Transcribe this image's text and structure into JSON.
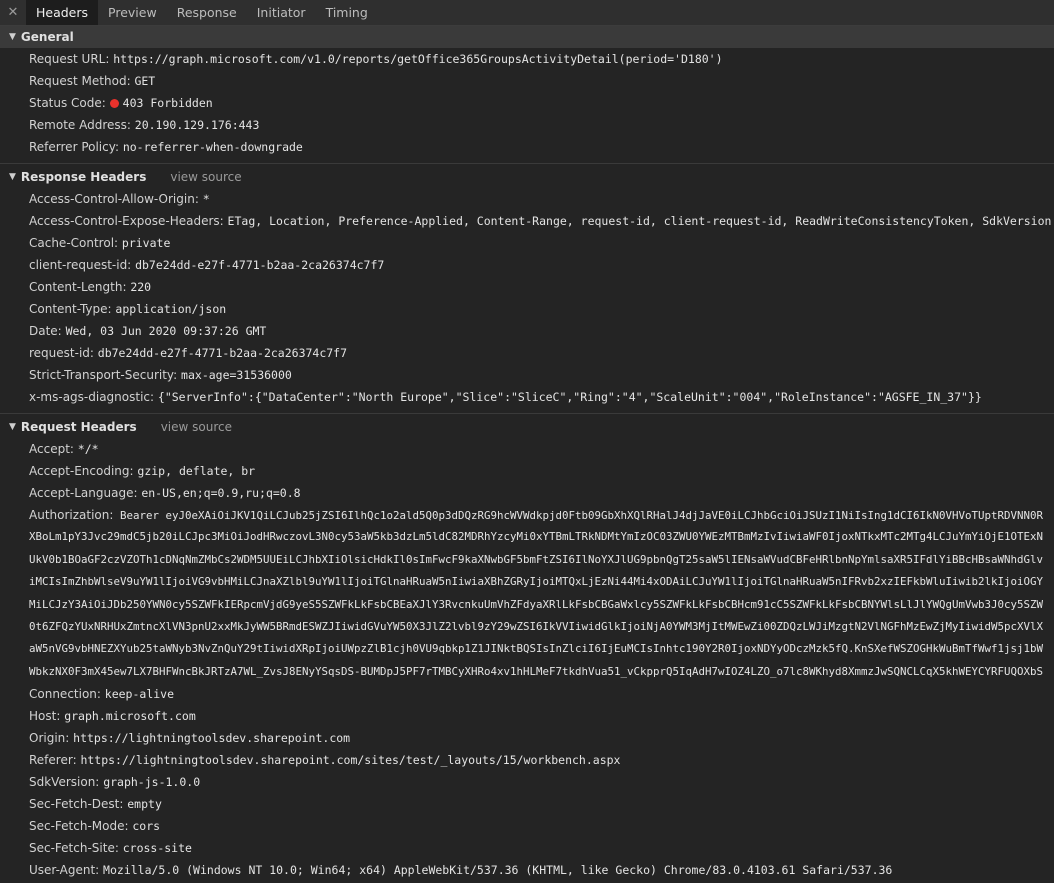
{
  "tabs": {
    "close": "✕",
    "items": [
      "Headers",
      "Preview",
      "Response",
      "Initiator",
      "Timing"
    ]
  },
  "general": {
    "title": "General",
    "rows": [
      {
        "name": "Request URL:",
        "value": "https://graph.microsoft.com/v1.0/reports/getOffice365GroupsActivityDetail(period='D180')"
      },
      {
        "name": "Request Method:",
        "value": "GET"
      },
      {
        "name": "Status Code:",
        "value": "403 Forbidden"
      },
      {
        "name": "Remote Address:",
        "value": "20.190.129.176:443"
      },
      {
        "name": "Referrer Policy:",
        "value": "no-referrer-when-downgrade"
      }
    ]
  },
  "response_headers": {
    "title": "Response Headers",
    "view_source": "view source",
    "rows": [
      {
        "name": "Access-Control-Allow-Origin:",
        "value": "*"
      },
      {
        "name": "Access-Control-Expose-Headers:",
        "value": "ETag, Location, Preference-Applied, Content-Range, request-id, client-request-id, ReadWriteConsistencyToken, SdkVersion"
      },
      {
        "name": "Cache-Control:",
        "value": "private"
      },
      {
        "name": "client-request-id:",
        "value": "db7e24dd-e27f-4771-b2aa-2ca26374c7f7"
      },
      {
        "name": "Content-Length:",
        "value": "220"
      },
      {
        "name": "Content-Type:",
        "value": "application/json"
      },
      {
        "name": "Date:",
        "value": "Wed, 03 Jun 2020 09:37:26 GMT"
      },
      {
        "name": "request-id:",
        "value": "db7e24dd-e27f-4771-b2aa-2ca26374c7f7"
      },
      {
        "name": "Strict-Transport-Security:",
        "value": "max-age=31536000"
      },
      {
        "name": "x-ms-ags-diagnostic:",
        "value": "{\"ServerInfo\":{\"DataCenter\":\"North Europe\",\"Slice\":\"SliceC\",\"Ring\":\"4\",\"ScaleUnit\":\"004\",\"RoleInstance\":\"AGSFE_IN_37\"}}"
      }
    ]
  },
  "request_headers": {
    "title": "Request Headers",
    "view_source": "view source",
    "rows_before": [
      {
        "name": "Accept:",
        "value": "*/*"
      },
      {
        "name": "Accept-Encoding:",
        "value": "gzip, deflate, br"
      },
      {
        "name": "Accept-Language:",
        "value": "en-US,en;q=0.9,ru;q=0.8"
      }
    ],
    "authorization": {
      "name": "Authorization:",
      "first": "Bearer eyJ0eXAiOiJKV1QiLCJub25jZSI6IlhQc1o2ald5Q0p3dDQzRG9hcWVWdkpjd0Ftb09GbXhXQlRHalJ4djJaVE0iLCJhbGciOiJSUzI1NiIsIng1dCI6IkN0VHVoTUptRDVNN0R",
      "lines": [
        "XBoLm1pY3Jvc29mdC5jb20iLCJpc3MiOiJodHRwczovL3N0cy53aW5kb3dzLm5ldC82MDRhYzcyMi0xYTBmLTRkNDMtYmIzOC03ZWU0YWEzMTBmMzIvIiwiaWF0IjoxNTkxMTc2MTg4LCJuYmYiOjE1OTExN",
        "UkV0b1BOaGF2czVZOTh1cDNqNmZMbCs2WDM5UUEiLCJhbXIiOlsicHdkIl0sImFwcF9kaXNwbGF5bmFtZSI6IlNoYXJlUG9pbnQgT25saW5lIENsaWVudCBFeHRlbnNpYmlsaXR5IFdlYiBBcHBsaWNhdGlv",
        "iMCIsImZhbWlseV9uYW1lIjoiVG9vbHMiLCJnaXZlbl9uYW1lIjoiTGlnaHRuaW5nIiwiaXBhZGRyIjoiMTQxLjEzNi44Mi4xODAiLCJuYW1lIjoiTGlnaHRuaW5nIFRvb2xzIEFkbWluIiwib2lkIjoiOGY",
        "MiLCJzY3AiOiJDb250YWN0cy5SZWFkIERpcmVjdG9yeS5SZWFkLkFsbCBEaXJlY3RvcnkuUmVhZFdyaXRlLkFsbCBGaWxlcy5SZWFkLkFsbCBHcm91cC5SZWFkLkFsbCBNYWlsLlJlYWQgUmVwb3J0cy5SZW",
        "0t6ZFQzYUxNRHUxZmtncXlVN3pnU2xxMkJyWW5BRmdESWZJIiwidGVuYW50X3JlZ2lvbl9zY29wZSI6IkVVIiwidGlkIjoiNjA0YWM3MjItMWEwZi00ZDQzLWJiMzgtN2VlNGFhMzEwZjMyIiwidW5pcXVlX",
        "aW5nVG9vbHNEZXYub25taWNyb3NvZnQuY29tIiwidXRpIjoiUWpzZlB1cjh0VU9qbkp1Z1JINktBQSIsInZlciI6IjEuMCIsInhtc190Y2R0IjoxNDYyODczMzk5fQ.KnSXefWSZOGHkWuBmTfWwf1jsj1bW",
        "WbkzNX0F3mX45ew7LX7BHFWncBkJRTzA7WL_ZvsJ8ENyYSqsDS-BUMDpJ5PF7rTMBCyXHRo4xv1hHLMeF7tkdhVua51_vCkpprQ5IqAdH7wIOZ4LZO_o7lc8WKhyd8XmmzJwSQNCLCqX5khWEYCYRFUQOXbS"
      ]
    },
    "rows_after": [
      {
        "name": "Connection:",
        "value": "keep-alive"
      },
      {
        "name": "Host:",
        "value": "graph.microsoft.com"
      },
      {
        "name": "Origin:",
        "value": "https://lightningtoolsdev.sharepoint.com"
      },
      {
        "name": "Referer:",
        "value": "https://lightningtoolsdev.sharepoint.com/sites/test/_layouts/15/workbench.aspx"
      },
      {
        "name": "SdkVersion:",
        "value": "graph-js-1.0.0"
      },
      {
        "name": "Sec-Fetch-Dest:",
        "value": "empty"
      },
      {
        "name": "Sec-Fetch-Mode:",
        "value": "cors"
      },
      {
        "name": "Sec-Fetch-Site:",
        "value": "cross-site"
      },
      {
        "name": "User-Agent:",
        "value": "Mozilla/5.0 (Windows NT 10.0; Win64; x64) AppleWebKit/537.36 (KHTML, like Gecko) Chrome/83.0.4103.61 Safari/537.36"
      }
    ]
  },
  "colors": {
    "status_dot": "#e8322c",
    "background": "#242424",
    "tabbar": "#2f2f2f"
  }
}
